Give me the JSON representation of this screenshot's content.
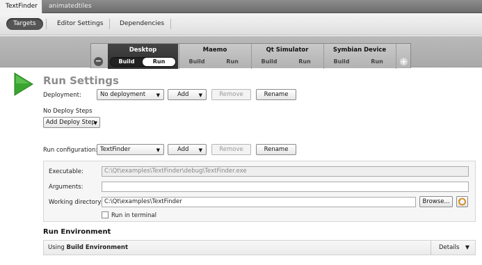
{
  "project_tabs": [
    "TextFinder",
    "animatedtiles"
  ],
  "modes": [
    "Targets",
    "Editor Settings",
    "Dependencies"
  ],
  "targets": [
    {
      "name": "Desktop",
      "build": "Build",
      "run": "Run"
    },
    {
      "name": "Maemo",
      "build": "Build",
      "run": "Run"
    },
    {
      "name": "Qt Simulator",
      "build": "Build",
      "run": "Run"
    },
    {
      "name": "Symbian Device",
      "build": "Build",
      "run": "Run"
    }
  ],
  "remove_target_symbol": "−",
  "add_target_symbol": "+",
  "run_settings": {
    "title": "Run Settings",
    "deployment_label": "Deployment:",
    "deployment_value": "No deployment",
    "add_label": "Add",
    "remove_label": "Remove",
    "rename_label": "Rename",
    "no_deploy_steps": "No Deploy Steps",
    "add_deploy_step": "Add Deploy Step",
    "run_config_label": "Run configuration:",
    "run_config_value": "TextFinder",
    "executable_label": "Executable:",
    "executable_value": "C:\\Qt\\examples\\TextFinder\\debug\\TextFinder.exe",
    "arguments_label": "Arguments:",
    "arguments_value": "",
    "working_dir_label": "Working directory:",
    "working_dir_value": "C:\\Qt\\examples\\TextFinder",
    "browse_label": "Browse...",
    "run_in_terminal_label": "Run in terminal"
  },
  "run_environment": {
    "title": "Run Environment",
    "using_prefix": "Using ",
    "using_value": "Build Environment",
    "details_label": "Details"
  },
  "colors": {
    "play_green": "#3aa530",
    "active_target": "#333333"
  }
}
